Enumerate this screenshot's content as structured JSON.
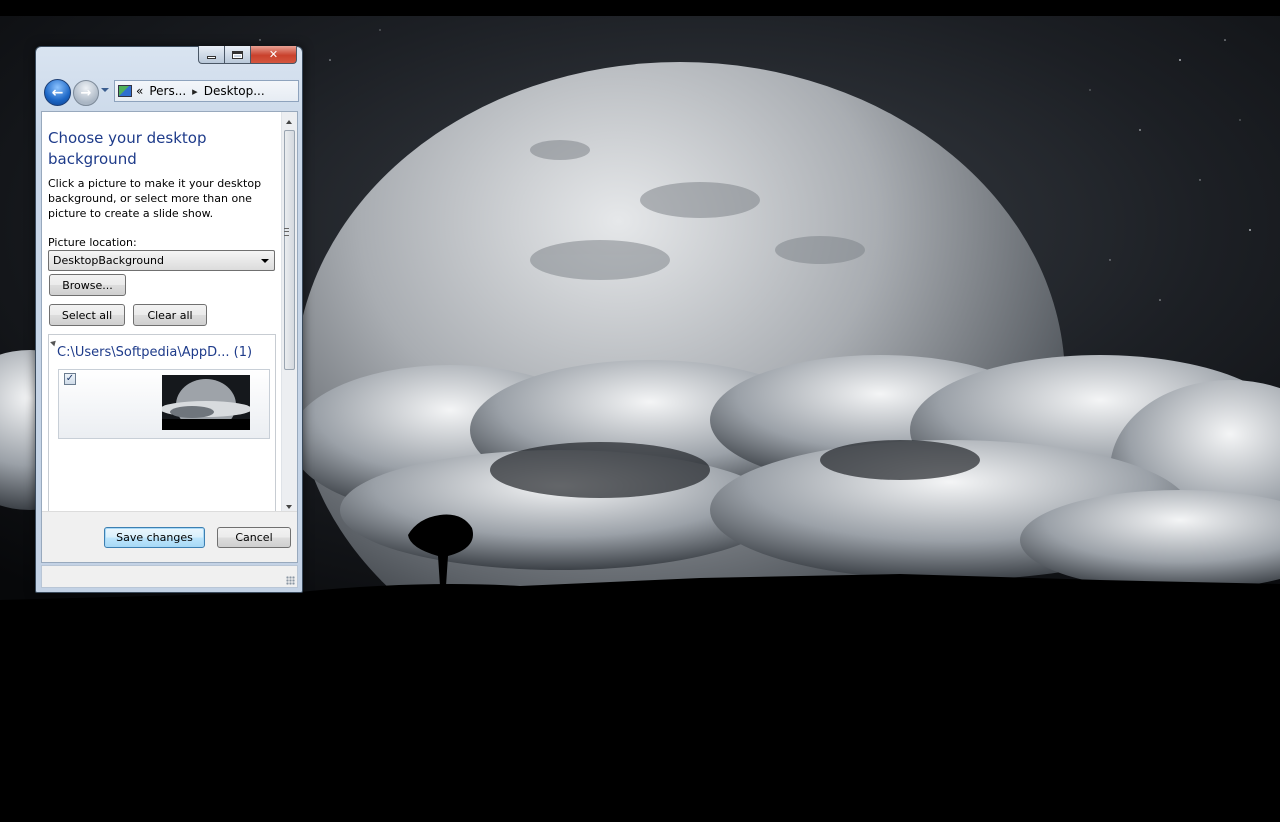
{
  "window": {
    "address": {
      "prefix": "«",
      "crumbs": [
        "Pers...",
        "Desktop..."
      ]
    },
    "content": {
      "title": "Choose your desktop background",
      "description": "Click a picture to make it your desktop background, or select more than one picture to create a slide show.",
      "location_label": "Picture location:",
      "location_value": "DesktopBackground",
      "browse_label": "Browse...",
      "select_all_label": "Select all",
      "clear_all_label": "Clear all",
      "group_header": "C:\\Users\\Softpedia\\AppD... (1)",
      "thumbnail_checked": "✓"
    },
    "footer": {
      "save_label": "Save changes",
      "cancel_label": "Cancel"
    },
    "icons": [
      "back-arrow-icon",
      "forward-arrow-icon",
      "personalization-icon",
      "minimize-icon",
      "maximize-icon",
      "close-icon"
    ]
  }
}
